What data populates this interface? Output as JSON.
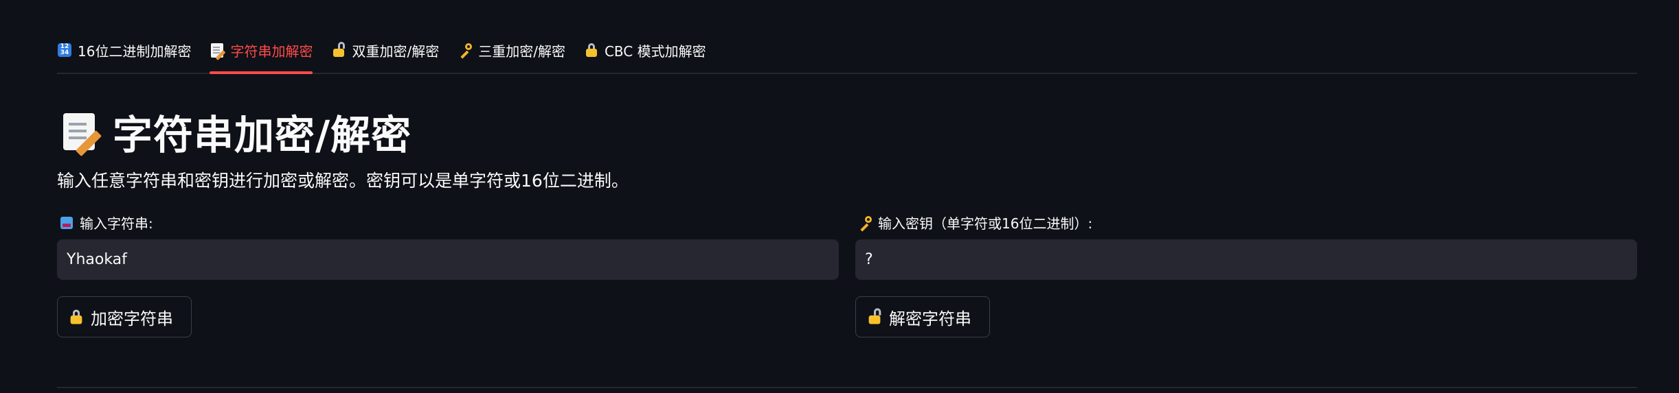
{
  "tabs": [
    {
      "label": "16位二进制加解密",
      "icon": "input-numbers-icon",
      "active": false
    },
    {
      "label": "字符串加解密",
      "icon": "memo-icon",
      "active": true
    },
    {
      "label": "双重加密/解密",
      "icon": "lock-with-key-icon",
      "active": false
    },
    {
      "label": "三重加密/解密",
      "icon": "key-icon",
      "active": false
    },
    {
      "label": "CBC 模式加解密",
      "icon": "lock-icon",
      "active": false
    }
  ],
  "tab_number_icon_text": {
    "top": "12",
    "bottom": "34"
  },
  "header": {
    "title": "字符串加密/解密",
    "description": "输入任意字符串和密钥进行加密或解密。密钥可以是单字符或16位二进制。"
  },
  "left_panel": {
    "label": "输入字符串:",
    "input_value": "Yhaokaf",
    "button_label": "加密字符串"
  },
  "right_panel": {
    "label": "输入密钥（单字符或16位二进制）:",
    "input_value": "?",
    "button_label": "解密字符串"
  },
  "colors": {
    "background": "#0e1117",
    "accent": "#ff4b4b",
    "input_bg": "#262730"
  }
}
